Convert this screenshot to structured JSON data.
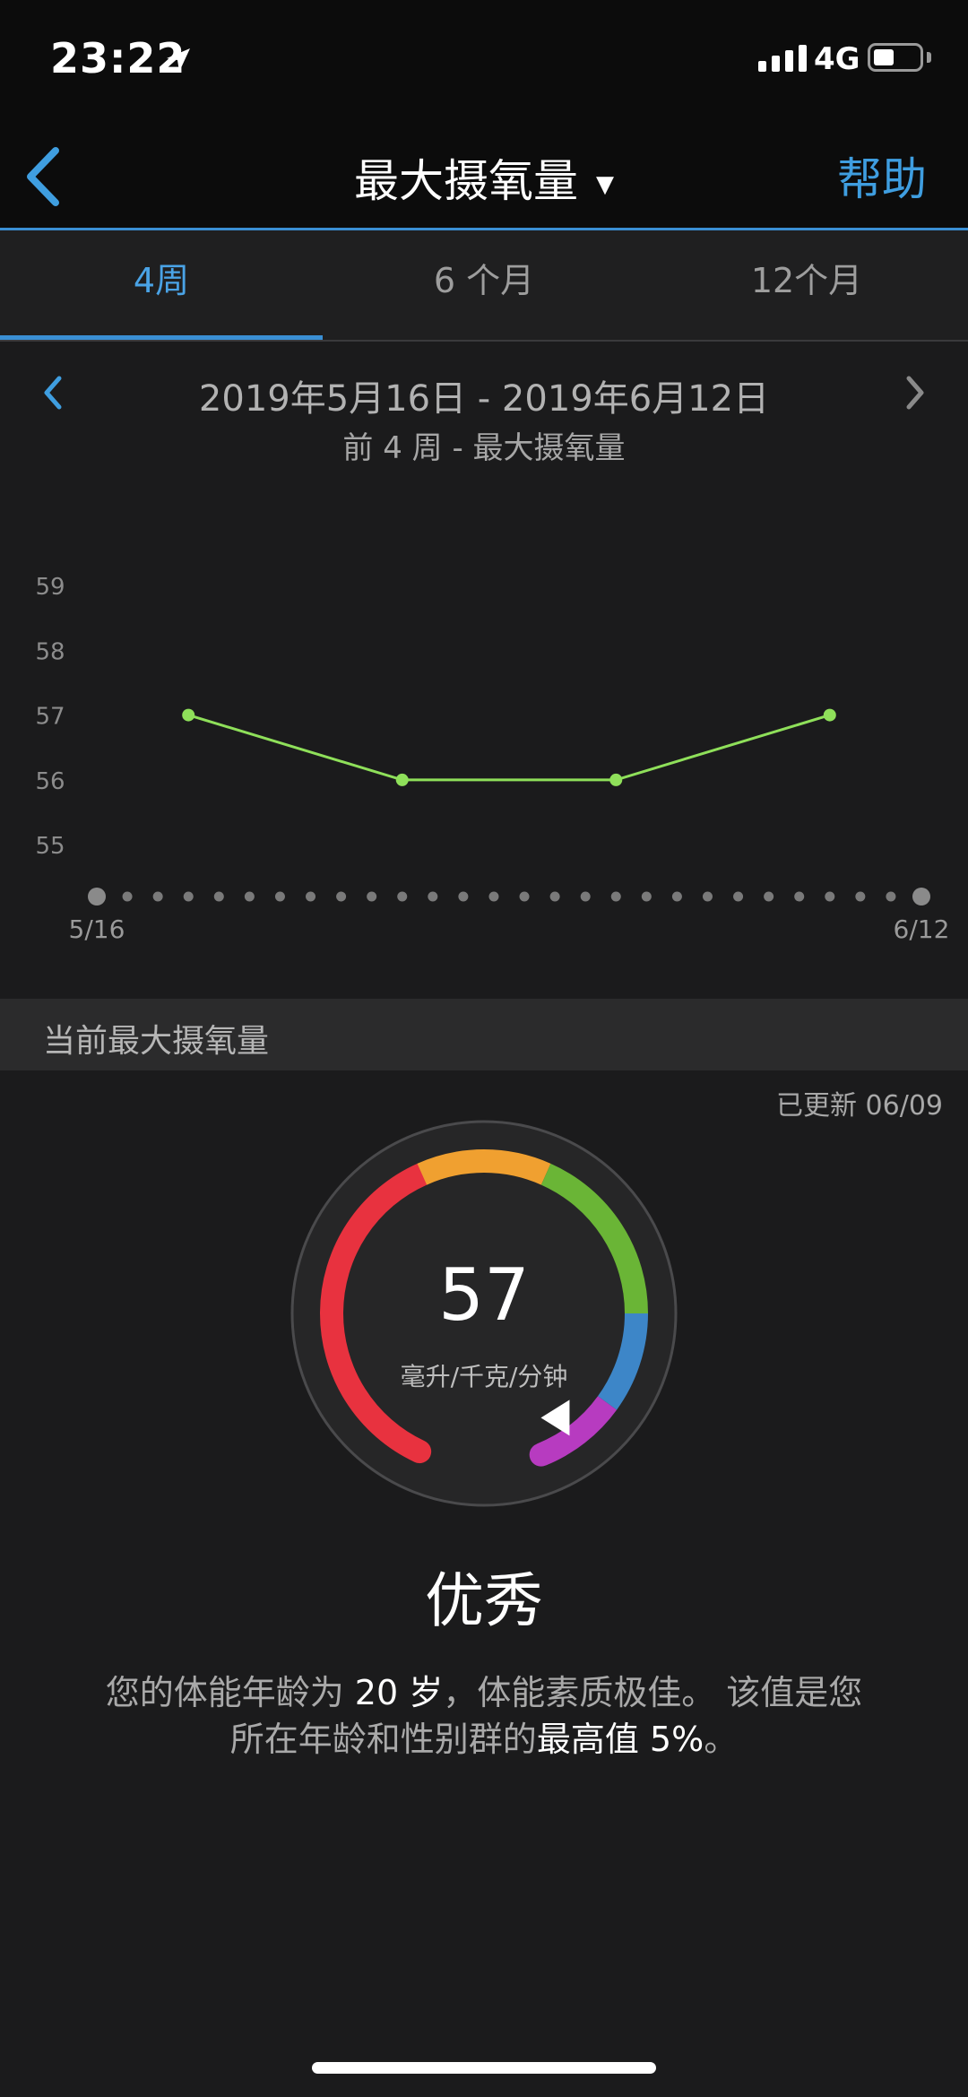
{
  "status_bar": {
    "time": "23:22",
    "network": "4G"
  },
  "nav": {
    "title": "最大摄氧量",
    "help": "帮助"
  },
  "tabs": [
    "4周",
    "6 个月",
    "12个月"
  ],
  "date_range": {
    "title": "2019年5月16日 - 2019年6月12日",
    "subtitle": "前 4 周 - 最大摄氧量"
  },
  "chart_data": {
    "type": "line",
    "title": "",
    "xlabel": "",
    "ylabel": "",
    "x_tick_labels": [
      "5/16",
      "6/12"
    ],
    "y_ticks": [
      59,
      58,
      57,
      56,
      55
    ],
    "ylim": [
      54.2,
      59.3
    ],
    "x_days": 28,
    "series": [
      {
        "x": [
          "5/19",
          "5/26",
          "6/02",
          "6/09"
        ],
        "x_index": [
          3,
          10,
          17,
          24
        ],
        "values": [
          57,
          56,
          56,
          57
        ]
      }
    ],
    "line_color": "#8fe05a",
    "grid": false
  },
  "current": {
    "section_title": "当前最大摄氧量",
    "updated": "已更新 06/09",
    "value": "57",
    "unit": "毫升/千克/分钟",
    "rating": "优秀",
    "desc_line1_pre": "您的体能年龄为 ",
    "desc_age": "20 岁",
    "desc_line1_post": "，体能素质极佳。 该值是您",
    "desc_line2_pre": "所在年龄和性别群的",
    "desc_highlight": "最高值 5%",
    "desc_end": "。"
  },
  "gauge_colors": {
    "poor": "#e8323f",
    "fair": "#f0a030",
    "good": "#6ab536",
    "excellent": "#3d86c8",
    "superior": "#b73bc0"
  },
  "colors": {
    "accent": "#3f9ee0",
    "line": "#8fe05a"
  }
}
